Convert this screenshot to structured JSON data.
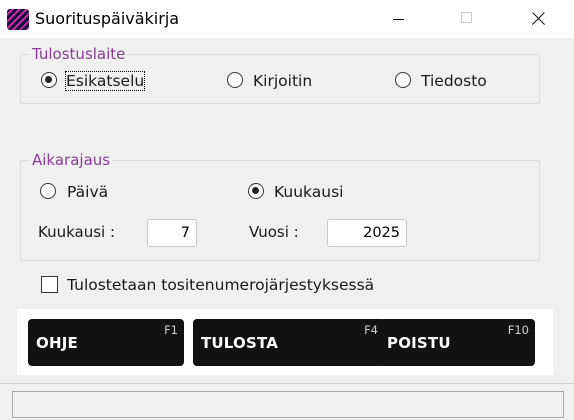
{
  "window": {
    "title": "Suorituspäiväkirja"
  },
  "output_device": {
    "legend": "Tulostuslaite",
    "options": [
      {
        "label": "Esikatselu",
        "selected": true
      },
      {
        "label": "Kirjoitin",
        "selected": false
      },
      {
        "label": "Tiedosto",
        "selected": false
      }
    ]
  },
  "time_range": {
    "legend": "Aikarajaus",
    "options": [
      {
        "label": "Päivä",
        "selected": false
      },
      {
        "label": "Kuukausi",
        "selected": true
      }
    ],
    "month_label": "Kuukausi :",
    "month_value": "7",
    "year_label": "Vuosi :",
    "year_value": "2025"
  },
  "print_by_voucher": {
    "label": "Tulostetaan tositenumerojärjestyksessä",
    "checked": false
  },
  "buttons": {
    "help": {
      "label": "OHJE",
      "key": "F1"
    },
    "print": {
      "label": "TULOSTA",
      "key": "F4"
    },
    "exit": {
      "label": "POISTU",
      "key": "F10"
    }
  },
  "status": {
    "text": ""
  }
}
